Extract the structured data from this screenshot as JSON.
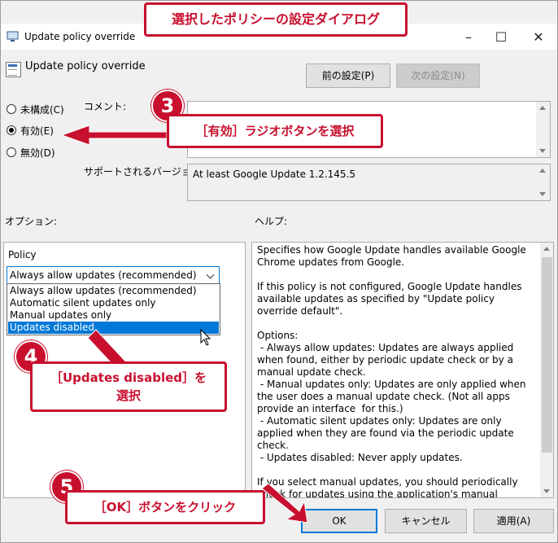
{
  "window": {
    "title": "Update policy override",
    "header_title": "Update policy override"
  },
  "buttons": {
    "prev_setting": "前の設定(P)",
    "next_setting": "次の設定(N)",
    "ok": "OK",
    "cancel": "キャンセル",
    "apply": "適用(A)"
  },
  "radios": [
    {
      "label": "未構成(C)",
      "checked": false
    },
    {
      "label": "有効(E)",
      "checked": true
    },
    {
      "label": "無効(D)",
      "checked": false
    }
  ],
  "labels": {
    "comment": "コメント:",
    "supported_versions": "サポートされるバージョン:",
    "options": "オプション:",
    "help": "ヘルプ:",
    "policy": "Policy"
  },
  "supported_version_value": "At least Google Update 1.2.145.5",
  "policy_select": {
    "selected": "Always allow updates (recommended)",
    "options": [
      "Always allow updates (recommended)",
      "Automatic silent updates only",
      "Manual updates only",
      "Updates disabled"
    ],
    "highlighted_index": 3
  },
  "help_text": "Specifies how Google Update handles available Google Chrome updates from Google.\n\nIf this policy is not configured, Google Update handles available updates as specified by \"Update policy override default\".\n\nOptions:\n - Always allow updates: Updates are always applied when found, either by periodic update check or by a manual update check.\n - Manual updates only: Updates are only applied when the user does a manual update check. (Not all apps provide an interface  for this.)\n - Automatic silent updates only: Updates are only applied when they are found via the periodic update check.\n - Updates disabled: Never apply updates.\n\nIf you select manual updates, you should periodically check for updates using the application's manual update mechanism if available. If you disable updates, you should",
  "annotations": {
    "top_callout": "選択したポリシーの設定ダイアログ",
    "step3_number": "3",
    "step3_text": "［有効］ラジオボタンを選択",
    "step4_number": "4",
    "step4_line1": "［Updates disabled］を",
    "step4_line2": "選択",
    "step5_number": "5",
    "step5_text": "［OK］ボタンをクリック"
  },
  "colors": {
    "annotation_red": "#c8102e",
    "selection_blue": "#0078d7"
  }
}
